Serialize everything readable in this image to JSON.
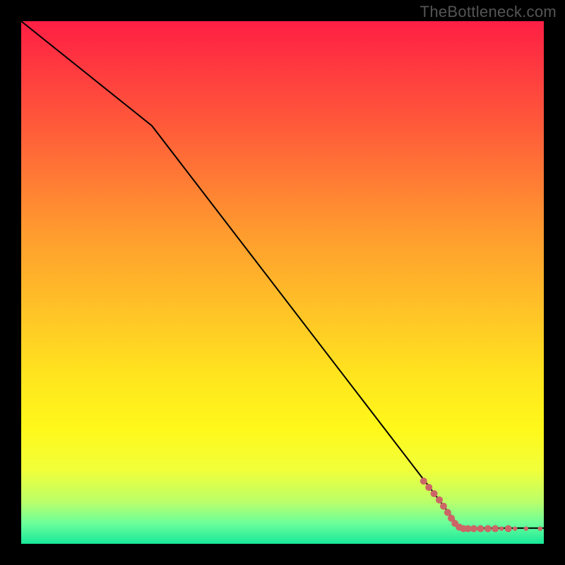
{
  "watermark": "TheBottleneck.com",
  "chart_data": {
    "type": "line",
    "title": "",
    "xlabel": "",
    "ylabel": "",
    "xlim": [
      0,
      100
    ],
    "ylim": [
      0,
      100
    ],
    "grid": false,
    "gradient_stops": [
      {
        "offset": 0.0,
        "color": "#ff1f44"
      },
      {
        "offset": 0.2,
        "color": "#ff5a3a"
      },
      {
        "offset": 0.4,
        "color": "#ff9a2f"
      },
      {
        "offset": 0.55,
        "color": "#ffc227"
      },
      {
        "offset": 0.68,
        "color": "#ffe51e"
      },
      {
        "offset": 0.78,
        "color": "#fff81a"
      },
      {
        "offset": 0.86,
        "color": "#f0ff3a"
      },
      {
        "offset": 0.92,
        "color": "#baff6a"
      },
      {
        "offset": 0.96,
        "color": "#6dff9a"
      },
      {
        "offset": 1.0,
        "color": "#18e899"
      }
    ],
    "series": [
      {
        "name": "curve",
        "x": [
          0,
          25,
          78,
          84,
          100
        ],
        "y": [
          100,
          80,
          11,
          3,
          3
        ],
        "stroke": "#000000",
        "stroke_width": 2
      }
    ],
    "points": {
      "name": "tail-points",
      "color": "#cc6666",
      "radius_large": 5,
      "radius_small": 3.2,
      "data": [
        {
          "x": 77.0,
          "y": 12.0,
          "r": "l"
        },
        {
          "x": 78.0,
          "y": 10.8,
          "r": "l"
        },
        {
          "x": 79.0,
          "y": 9.6,
          "r": "l"
        },
        {
          "x": 80.0,
          "y": 8.4,
          "r": "l"
        },
        {
          "x": 80.8,
          "y": 7.2,
          "r": "l"
        },
        {
          "x": 81.6,
          "y": 6.0,
          "r": "l"
        },
        {
          "x": 82.3,
          "y": 4.9,
          "r": "l"
        },
        {
          "x": 83.0,
          "y": 3.9,
          "r": "l"
        },
        {
          "x": 83.8,
          "y": 3.2,
          "r": "l"
        },
        {
          "x": 84.6,
          "y": 2.9,
          "r": "l"
        },
        {
          "x": 85.5,
          "y": 2.9,
          "r": "l"
        },
        {
          "x": 86.6,
          "y": 2.9,
          "r": "l"
        },
        {
          "x": 87.9,
          "y": 2.9,
          "r": "l"
        },
        {
          "x": 89.3,
          "y": 2.9,
          "r": "l"
        },
        {
          "x": 90.7,
          "y": 2.9,
          "r": "l"
        },
        {
          "x": 91.9,
          "y": 2.9,
          "r": "s"
        },
        {
          "x": 93.2,
          "y": 2.9,
          "r": "l"
        },
        {
          "x": 94.5,
          "y": 2.9,
          "r": "s"
        },
        {
          "x": 96.6,
          "y": 2.9,
          "r": "s"
        },
        {
          "x": 99.3,
          "y": 2.9,
          "r": "s"
        }
      ]
    }
  }
}
